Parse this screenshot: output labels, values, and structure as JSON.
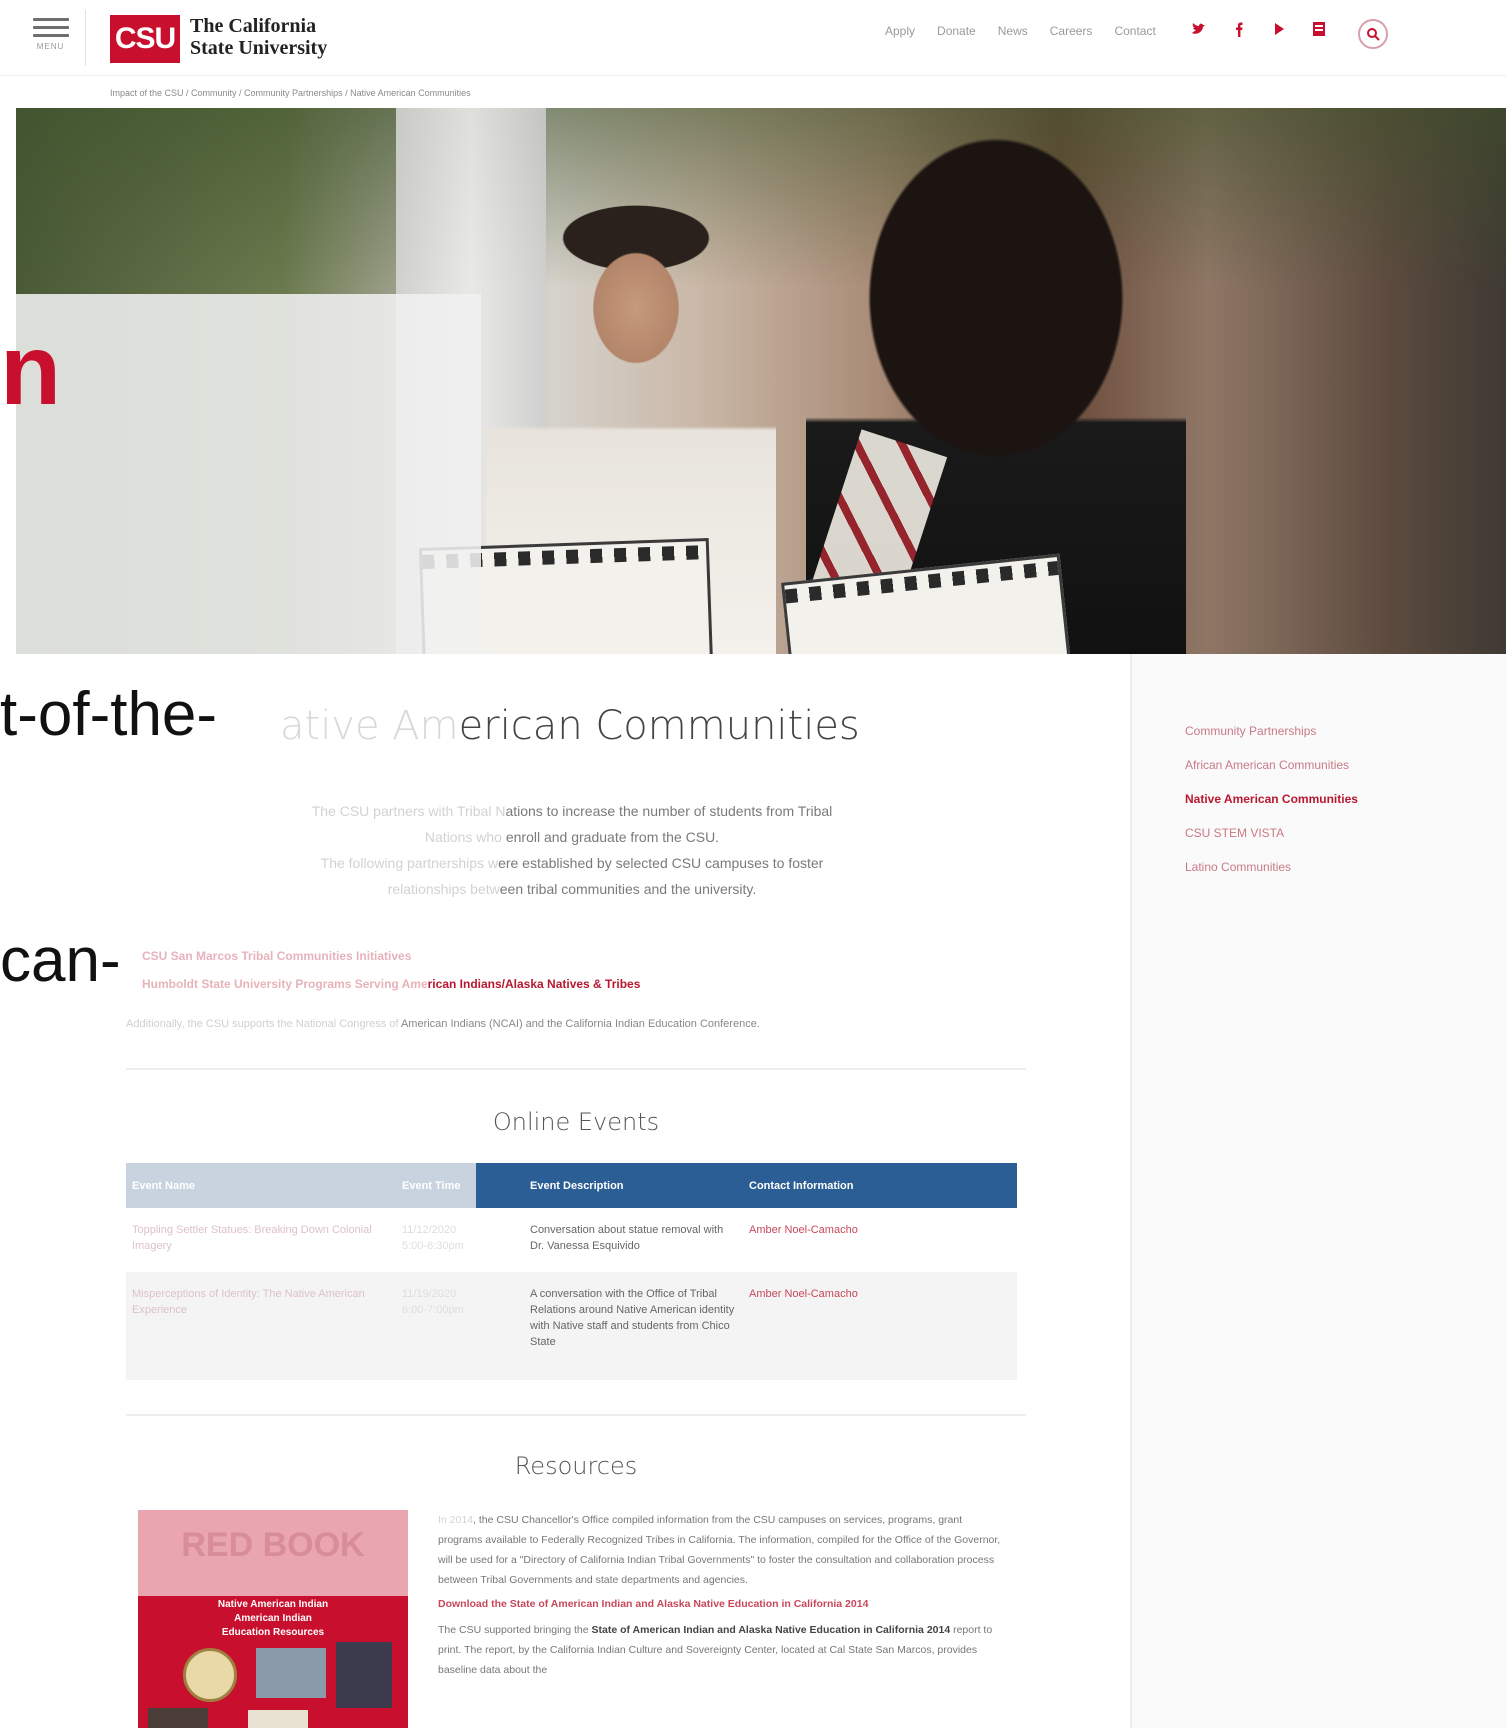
{
  "header": {
    "menu_label": "MENU",
    "logo_mark": "CSU",
    "logo_line1": "The California",
    "logo_line2": "State University",
    "nav": [
      "Apply",
      "Donate",
      "News",
      "Careers",
      "Contact"
    ],
    "social_icons": [
      "twitter-icon",
      "facebook-icon",
      "youtube-icon",
      "rss-icon"
    ],
    "search_icon": "search-icon",
    "accent": "#c8102e"
  },
  "breadcrumb": "Impact of the CSU  /  Community  /  Community Partnerships  /  Native American Communities",
  "hero": {
    "title_fragment": "n"
  },
  "overflow_fragments": {
    "line1": "t-of-the-",
    "line2": "can-"
  },
  "main": {
    "title_faded": "ative Am",
    "title_rest": "erican Communities",
    "intro_p1_faded": "The CSU partners with Tribal N",
    "intro_p1_rest": "ations to increase the number of students from Tribal",
    "intro_p1b_faded": "Nations who",
    "intro_p1b_rest": " enroll and graduate from the CSU.",
    "intro_p2_faded": "The following partnerships w",
    "intro_p2_rest": "ere established by selected CSU campuses to foster",
    "intro_p2b_faded": "relationships betw",
    "intro_p2b_rest": "een tribal communities and the university.",
    "link1": "CSU San Marcos Tribal Communities Initiatives",
    "link2_faded": "Humboldt State University Programs Serving Ame",
    "link2_rest": "rican Indians/Alaska Natives & Tribes",
    "additional_faded": "Additionally, the CSU supports the National Congress of ",
    "additional_rest": "American Indians (NCAI) and the California Indian Education Conference.",
    "events_title": "Online Events",
    "events_headers": [
      "Event Name",
      "Event Time",
      "Event Description",
      "Contact Information"
    ],
    "events": [
      {
        "name": "Toppling Settler Statues: Breaking Down Colonial Imagery",
        "time": "11/12/2020 5:00-6:30pm",
        "description": "Conversation about statue removal with Dr. Vanessa Esquivido",
        "contact": "Amber Noel-Camacho"
      },
      {
        "name": "Misperceptions of Identity: The Native American Experience",
        "time": "11/19/2020 6:00-7:00pm",
        "description": "A conversation with the Office of Tribal Relations around Native American identity with Native staff and students from Chico State",
        "contact": "Amber Noel-Camacho"
      }
    ],
    "resources_title": "Resources",
    "book": {
      "title": "RED BOOK",
      "sub1": "Native American Indian",
      "sub2": "American Indian",
      "sub3": "Education Resources"
    },
    "res_p1_faded": "In 2014",
    "res_p1_rest": ", the CSU Chancellor's Office compiled information from the CSU campuses on services, programs, grant programs available to Federally Recognized Tribes in California. The information, compiled for the Office of the Governor, will be used for a \"Directory of California Indian Tribal Governments\" to foster the consultation and collaboration process between Tribal Governments and state departments and agencies.",
    "res_download": "Download the State of American Indian and Alaska Native Education in California 2014",
    "res_p2_a": "The CSU supported bringing the ",
    "res_p2_b": "State of American Indian and Alaska Native Education in California 2014",
    "res_p2_c": " report to print. The report, by the California Indian Culture and Sovereignty Center, located at Cal State San Marcos, provides baseline data about the"
  },
  "sidebar": {
    "items": [
      {
        "label": "Community Partnerships",
        "active": false
      },
      {
        "label": "African American Communities",
        "active": false
      },
      {
        "label": "Native American Communities",
        "active": true
      },
      {
        "label": "CSU STEM VISTA",
        "active": false
      },
      {
        "label": "Latino Communities",
        "active": false
      }
    ]
  }
}
